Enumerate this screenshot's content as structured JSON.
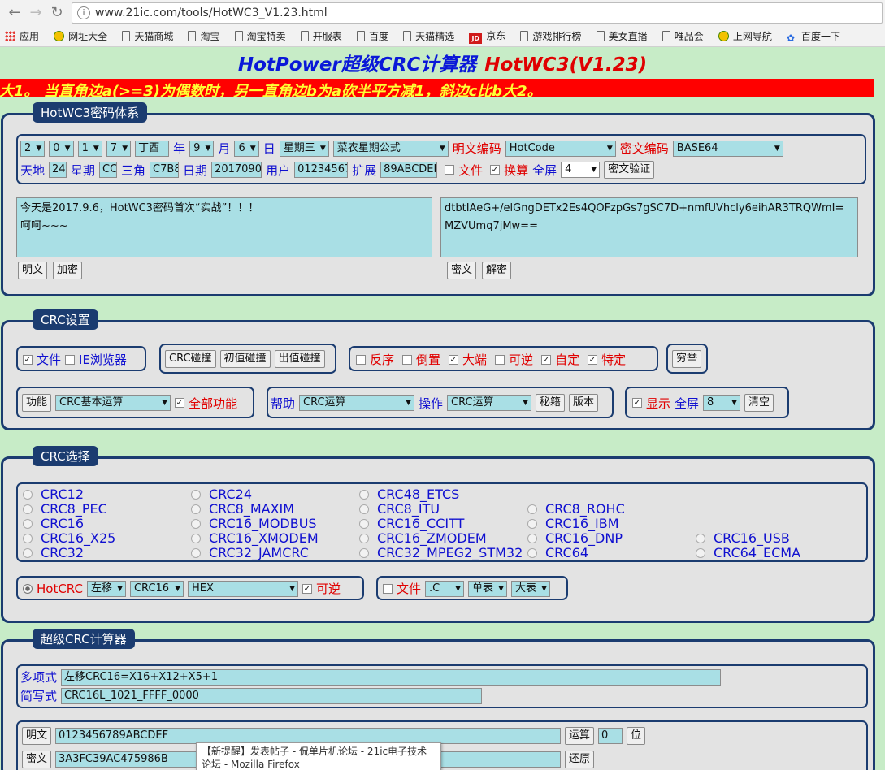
{
  "browser": {
    "url": "www.21ic.com/tools/HotWC3_V1.23.html",
    "bookmarks": [
      {
        "icon": "apps-icon",
        "label": "应用"
      },
      {
        "icon": "globe-icon",
        "label": "网址大全"
      },
      {
        "icon": "page-icon",
        "label": "天猫商城"
      },
      {
        "icon": "page-icon",
        "label": "淘宝"
      },
      {
        "icon": "page-icon",
        "label": "淘宝特卖"
      },
      {
        "icon": "page-icon",
        "label": "开服表"
      },
      {
        "icon": "page-icon",
        "label": "百度"
      },
      {
        "icon": "page-icon",
        "label": "天猫精选"
      },
      {
        "icon": "jd-icon",
        "label": "京东"
      },
      {
        "icon": "page-icon",
        "label": "游戏排行榜"
      },
      {
        "icon": "page-icon",
        "label": "美女直播"
      },
      {
        "icon": "page-icon",
        "label": "唯品会"
      },
      {
        "icon": "globe-icon",
        "label": "上网导航"
      },
      {
        "icon": "paw-icon",
        "label": "百度一下"
      }
    ]
  },
  "title": {
    "main": "HotPower超级CRC计算器",
    "version": "HotWC3(V1.23)"
  },
  "marquee": "b大1。  当直角边a(>=3)为偶数时，另一直角边b为a砍半平方减1，斜边c比b大2。",
  "s1": {
    "legend": "HotWC3密码体系",
    "row1": {
      "sel1": "2",
      "sel2": "0",
      "sel3": "1",
      "sel4": "7",
      "ganzhi": "丁酉",
      "year_lbl": "年",
      "month": "9",
      "month_lbl": "月",
      "day": "6",
      "day_lbl": "日",
      "weekday": "星期三",
      "formula": "菜农星期公式",
      "plain_enc_lbl": "明文编码",
      "plain_enc": "HotCode",
      "cipher_enc_lbl": "密文编码",
      "cipher_enc": "BASE64"
    },
    "row2": {
      "tiandi_lbl": "天地",
      "tiandi": "24",
      "week_lbl": "星期",
      "week": "CC",
      "sanjiao_lbl": "三角",
      "sanjiao": "C7B8",
      "date_lbl": "日期",
      "date": "20170906",
      "user_lbl": "用户",
      "user": "01234567",
      "ext_lbl": "扩展",
      "ext": "89ABCDEF",
      "file_lbl": "文件",
      "calc_lbl": "换算",
      "full_lbl": "全屏",
      "full": "4",
      "verify_btn": "密文验证"
    },
    "plain_text": "今天是2017.9.6，HotWC3密码首次“实战”！！！\n呵呵~~~",
    "cipher_text": "dtbtIAeG+/elGngDETx2Es4QOFzpGs7gSC7D+nmfUVhcly6eihAR3TRQWmI=\nMZVUmq7jMw==",
    "btn_plain": "明文",
    "btn_encrypt": "加密",
    "btn_cipher": "密文",
    "btn_decrypt": "解密"
  },
  "s2": {
    "legend": "CRC设置",
    "file_lbl": "文件",
    "ie_lbl": "IE浏览器",
    "btn_collide": "CRC碰撞",
    "btn_init": "初值碰撞",
    "btn_out": "出值碰撞",
    "reverse_lbl": "反序",
    "invert_lbl": "倒置",
    "bigendian_lbl": "大端",
    "reversible_lbl": "可逆",
    "custom_lbl": "自定",
    "special_lbl": "特定",
    "btn_exhaust": "穷举",
    "btn_func": "功能",
    "func_sel": "CRC基本运算",
    "allfunc_lbl": "全部功能",
    "help_lbl": "帮助",
    "help_sel": "CRC运算",
    "op_lbl": "操作",
    "op_sel": "CRC运算",
    "btn_secret": "秘籍",
    "btn_version": "版本",
    "show_lbl": "显示",
    "fullscreen_lbl": "全屏",
    "fullscreen_sel": "8",
    "btn_clear": "清空"
  },
  "s3": {
    "legend": "CRC选择",
    "col1": [
      "CRC12",
      "CRC8_PEC",
      "CRC16",
      "CRC16_X25",
      "CRC32"
    ],
    "col2": [
      "CRC24",
      "CRC8_MAXIM",
      "CRC16_MODBUS",
      "CRC16_XMODEM",
      "CRC32_JAMCRC"
    ],
    "col3": [
      "CRC48_ETCS",
      "CRC8_ITU",
      "CRC16_CCITT",
      "CRC16_ZMODEM",
      "CRC32_MPEG2_STM32"
    ],
    "col4": [
      "CRC8_ROHC",
      "CRC16_IBM",
      "CRC16_DNP",
      "CRC64"
    ],
    "col5": [
      "CRC16_USB",
      "CRC64_ECMA"
    ],
    "hotcrc_lbl": "HotCRC",
    "shift_sel": "左移",
    "crc_sel": "CRC16",
    "fmt_sel": "HEX",
    "reversible_lbl": "可逆",
    "file_lbl": "文件",
    "ext_sel": ".C",
    "single_sel": "单表",
    "big_sel": "大表"
  },
  "s4": {
    "legend": "超级CRC计算器",
    "poly_lbl": "多项式",
    "poly": "左移CRC16=X16+X12+X5+1",
    "short_lbl": "简写式",
    "short": "CRC16L_1021_FFFF_0000",
    "btn_plain": "明文",
    "plain": "0123456789ABCDEF",
    "btn_calc": "运算",
    "bits": "0",
    "bits_lbl": "位",
    "btn_cipher": "密文",
    "cipher": "3A3FC39AC475986B",
    "btn_restore": "还原"
  },
  "tooltip": "【新提醒】发表帖子 - 侃单片机论坛 - 21ic电子技术论坛 - Mozilla Firefox"
}
